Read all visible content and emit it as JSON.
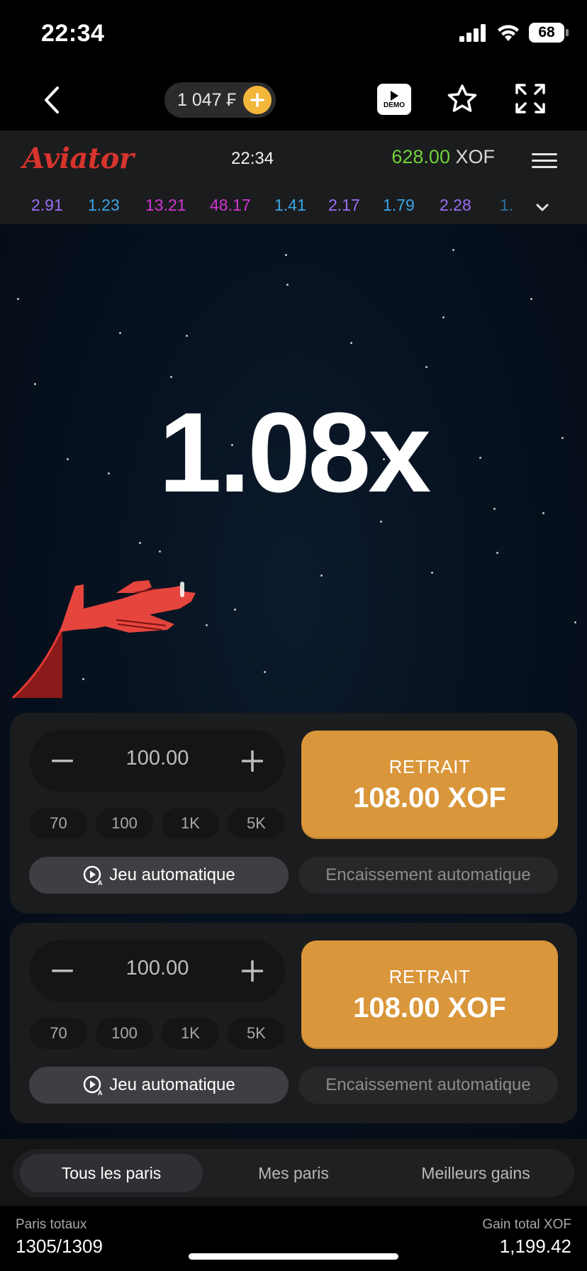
{
  "status_bar": {
    "time": "22:34",
    "battery": "68"
  },
  "app_nav": {
    "balance": "1 047 ₣",
    "demo_label": "DEMO"
  },
  "header": {
    "logo": "Aviator",
    "time": "22:34",
    "balance_amount": "628.00",
    "balance_currency": "XOF"
  },
  "history": [
    {
      "value": "2.91",
      "color": "#9b6cf5"
    },
    {
      "value": "1.23",
      "color": "#3aa5e6"
    },
    {
      "value": "13.21",
      "color": "#d236d3"
    },
    {
      "value": "48.17",
      "color": "#d236d3"
    },
    {
      "value": "1.41",
      "color": "#3aa5e6"
    },
    {
      "value": "2.17",
      "color": "#9b6cf5"
    },
    {
      "value": "1.79",
      "color": "#3aa5e6"
    },
    {
      "value": "2.28",
      "color": "#9b6cf5"
    },
    {
      "value": "1.",
      "color": "#2a6fa0"
    }
  ],
  "game": {
    "multiplier": "1.08x"
  },
  "bets": [
    {
      "amount": "100.00",
      "quick": [
        "70",
        "100",
        "1K",
        "5K"
      ],
      "cashout_label": "RETRAIT",
      "cashout_amount": "108.00 XOF",
      "auto_play": "Jeu automatique",
      "auto_cashout": "Encaissement automatique"
    },
    {
      "amount": "100.00",
      "quick": [
        "70",
        "100",
        "1K",
        "5K"
      ],
      "cashout_label": "RETRAIT",
      "cashout_amount": "108.00 XOF",
      "auto_play": "Jeu automatique",
      "auto_cashout": "Encaissement automatique"
    }
  ],
  "tabs": [
    "Tous les paris",
    "Mes paris",
    "Meilleurs gains"
  ],
  "footer": {
    "total_bets_label": "Paris totaux",
    "total_bets_value": "1305/1309",
    "total_win_label": "Gain total XOF",
    "total_win_value": "1,199.42"
  },
  "colors": {
    "accent_green": "#6fd13a",
    "cashout_orange": "#d9963a",
    "plane_red": "#e53935",
    "logo_red": "#d7342d"
  }
}
